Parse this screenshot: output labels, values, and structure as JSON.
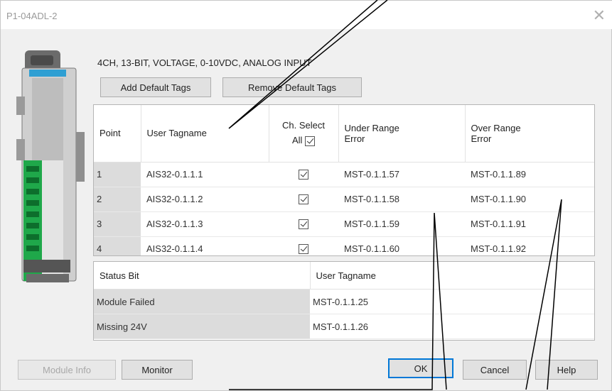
{
  "window": {
    "title": "P1-04ADL-2",
    "close_glyph": "✕"
  },
  "module": {
    "description": "4CH, 13-BIT, VOLTAGE, 0-10VDC, ANALOG INPUT"
  },
  "toolbar": {
    "add_default_tags": "Add Default Tags",
    "remove_default_tags": "Remove Default Tags"
  },
  "points_table": {
    "headers": {
      "point": "Point",
      "user_tagname": "User Tagname",
      "ch_select": "Ch. Select",
      "all": "All",
      "under_range_1": "Under Range",
      "under_range_2": "Error",
      "over_range_1": "Over Range",
      "over_range_2": "Error"
    },
    "rows": [
      {
        "point": "1",
        "tag": "AIS32-0.1.1.1",
        "checked": true,
        "under": "MST-0.1.1.57",
        "over": "MST-0.1.1.89"
      },
      {
        "point": "2",
        "tag": "AIS32-0.1.1.2",
        "checked": true,
        "under": "MST-0.1.1.58",
        "over": "MST-0.1.1.90"
      },
      {
        "point": "3",
        "tag": "AIS32-0.1.1.3",
        "checked": true,
        "under": "MST-0.1.1.59",
        "over": "MST-0.1.1.91"
      },
      {
        "point": "4",
        "tag": "AIS32-0.1.1.4",
        "checked": true,
        "under": "MST-0.1.1.60",
        "over": "MST-0.1.1.92"
      }
    ]
  },
  "status_table": {
    "headers": {
      "status_bit": "Status Bit",
      "user_tagname": "User Tagname"
    },
    "rows": [
      {
        "bit": "Module Failed",
        "tag": "MST-0.1.1.25"
      },
      {
        "bit": "Missing 24V",
        "tag": "MST-0.1.1.26"
      }
    ]
  },
  "footer": {
    "module_info": "Module Info",
    "monitor": "Monitor",
    "ok": "OK",
    "cancel": "Cancel",
    "help": "Help"
  }
}
